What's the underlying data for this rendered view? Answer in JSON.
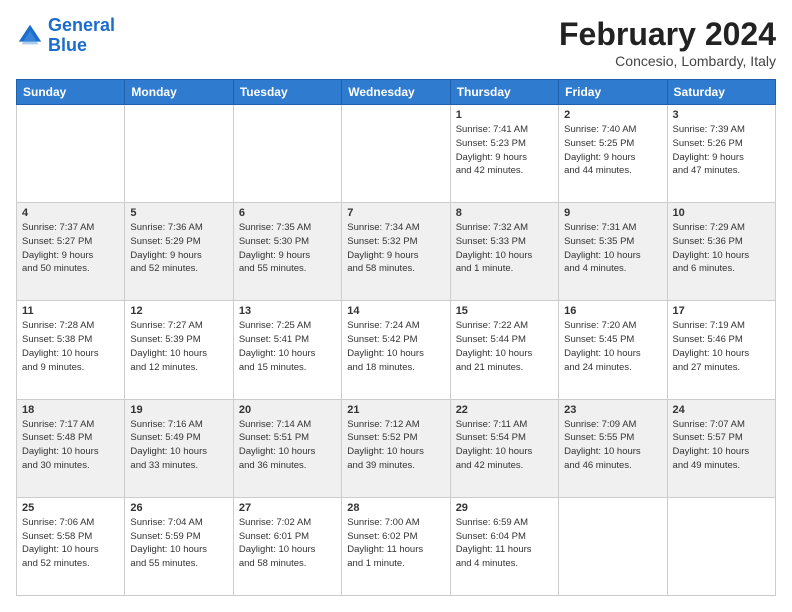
{
  "logo": {
    "line1": "General",
    "line2": "Blue"
  },
  "title": "February 2024",
  "subtitle": "Concesio, Lombardy, Italy",
  "days_of_week": [
    "Sunday",
    "Monday",
    "Tuesday",
    "Wednesday",
    "Thursday",
    "Friday",
    "Saturday"
  ],
  "weeks": [
    [
      {
        "day": "",
        "info": ""
      },
      {
        "day": "",
        "info": ""
      },
      {
        "day": "",
        "info": ""
      },
      {
        "day": "",
        "info": ""
      },
      {
        "day": "1",
        "info": "Sunrise: 7:41 AM\nSunset: 5:23 PM\nDaylight: 9 hours\nand 42 minutes."
      },
      {
        "day": "2",
        "info": "Sunrise: 7:40 AM\nSunset: 5:25 PM\nDaylight: 9 hours\nand 44 minutes."
      },
      {
        "day": "3",
        "info": "Sunrise: 7:39 AM\nSunset: 5:26 PM\nDaylight: 9 hours\nand 47 minutes."
      }
    ],
    [
      {
        "day": "4",
        "info": "Sunrise: 7:37 AM\nSunset: 5:27 PM\nDaylight: 9 hours\nand 50 minutes."
      },
      {
        "day": "5",
        "info": "Sunrise: 7:36 AM\nSunset: 5:29 PM\nDaylight: 9 hours\nand 52 minutes."
      },
      {
        "day": "6",
        "info": "Sunrise: 7:35 AM\nSunset: 5:30 PM\nDaylight: 9 hours\nand 55 minutes."
      },
      {
        "day": "7",
        "info": "Sunrise: 7:34 AM\nSunset: 5:32 PM\nDaylight: 9 hours\nand 58 minutes."
      },
      {
        "day": "8",
        "info": "Sunrise: 7:32 AM\nSunset: 5:33 PM\nDaylight: 10 hours\nand 1 minute."
      },
      {
        "day": "9",
        "info": "Sunrise: 7:31 AM\nSunset: 5:35 PM\nDaylight: 10 hours\nand 4 minutes."
      },
      {
        "day": "10",
        "info": "Sunrise: 7:29 AM\nSunset: 5:36 PM\nDaylight: 10 hours\nand 6 minutes."
      }
    ],
    [
      {
        "day": "11",
        "info": "Sunrise: 7:28 AM\nSunset: 5:38 PM\nDaylight: 10 hours\nand 9 minutes."
      },
      {
        "day": "12",
        "info": "Sunrise: 7:27 AM\nSunset: 5:39 PM\nDaylight: 10 hours\nand 12 minutes."
      },
      {
        "day": "13",
        "info": "Sunrise: 7:25 AM\nSunset: 5:41 PM\nDaylight: 10 hours\nand 15 minutes."
      },
      {
        "day": "14",
        "info": "Sunrise: 7:24 AM\nSunset: 5:42 PM\nDaylight: 10 hours\nand 18 minutes."
      },
      {
        "day": "15",
        "info": "Sunrise: 7:22 AM\nSunset: 5:44 PM\nDaylight: 10 hours\nand 21 minutes."
      },
      {
        "day": "16",
        "info": "Sunrise: 7:20 AM\nSunset: 5:45 PM\nDaylight: 10 hours\nand 24 minutes."
      },
      {
        "day": "17",
        "info": "Sunrise: 7:19 AM\nSunset: 5:46 PM\nDaylight: 10 hours\nand 27 minutes."
      }
    ],
    [
      {
        "day": "18",
        "info": "Sunrise: 7:17 AM\nSunset: 5:48 PM\nDaylight: 10 hours\nand 30 minutes."
      },
      {
        "day": "19",
        "info": "Sunrise: 7:16 AM\nSunset: 5:49 PM\nDaylight: 10 hours\nand 33 minutes."
      },
      {
        "day": "20",
        "info": "Sunrise: 7:14 AM\nSunset: 5:51 PM\nDaylight: 10 hours\nand 36 minutes."
      },
      {
        "day": "21",
        "info": "Sunrise: 7:12 AM\nSunset: 5:52 PM\nDaylight: 10 hours\nand 39 minutes."
      },
      {
        "day": "22",
        "info": "Sunrise: 7:11 AM\nSunset: 5:54 PM\nDaylight: 10 hours\nand 42 minutes."
      },
      {
        "day": "23",
        "info": "Sunrise: 7:09 AM\nSunset: 5:55 PM\nDaylight: 10 hours\nand 46 minutes."
      },
      {
        "day": "24",
        "info": "Sunrise: 7:07 AM\nSunset: 5:57 PM\nDaylight: 10 hours\nand 49 minutes."
      }
    ],
    [
      {
        "day": "25",
        "info": "Sunrise: 7:06 AM\nSunset: 5:58 PM\nDaylight: 10 hours\nand 52 minutes."
      },
      {
        "day": "26",
        "info": "Sunrise: 7:04 AM\nSunset: 5:59 PM\nDaylight: 10 hours\nand 55 minutes."
      },
      {
        "day": "27",
        "info": "Sunrise: 7:02 AM\nSunset: 6:01 PM\nDaylight: 10 hours\nand 58 minutes."
      },
      {
        "day": "28",
        "info": "Sunrise: 7:00 AM\nSunset: 6:02 PM\nDaylight: 11 hours\nand 1 minute."
      },
      {
        "day": "29",
        "info": "Sunrise: 6:59 AM\nSunset: 6:04 PM\nDaylight: 11 hours\nand 4 minutes."
      },
      {
        "day": "",
        "info": ""
      },
      {
        "day": "",
        "info": ""
      }
    ]
  ]
}
